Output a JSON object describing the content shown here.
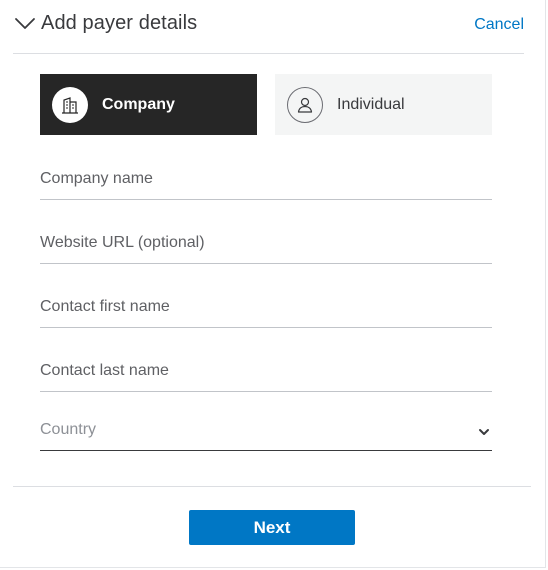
{
  "header": {
    "title": "Add payer details",
    "cancel_label": "Cancel",
    "collapse_icon": "chevron-down-icon"
  },
  "payer_type": {
    "selected": "company",
    "options": [
      {
        "key": "company",
        "label": "Company",
        "icon": "building-icon"
      },
      {
        "key": "individual",
        "label": "Individual",
        "icon": "person-icon"
      }
    ]
  },
  "form": {
    "company_name": {
      "placeholder": "Company name",
      "value": ""
    },
    "website_url": {
      "placeholder": "Website URL (optional)",
      "value": ""
    },
    "contact_first_name": {
      "placeholder": "Contact first name",
      "value": ""
    },
    "contact_last_name": {
      "placeholder": "Contact last name",
      "value": ""
    },
    "country": {
      "placeholder": "Country",
      "value": ""
    }
  },
  "footer": {
    "next_label": "Next"
  },
  "colors": {
    "accent": "#0077c5",
    "selected_bg": "#262626",
    "unselected_bg": "#f4f5f5"
  }
}
